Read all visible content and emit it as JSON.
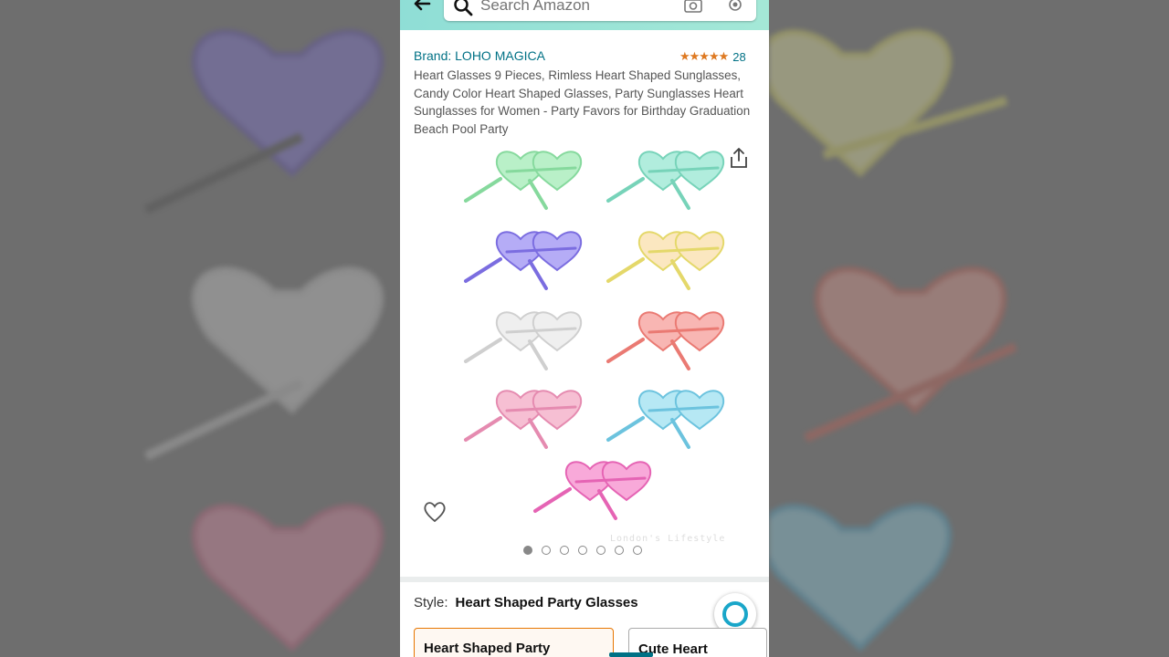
{
  "search": {
    "placeholder": "Search Amazon"
  },
  "product": {
    "brand": "Brand: LOHO MAGICA",
    "stars": "★★★★★",
    "rating": 4.5,
    "rating_count": "28",
    "title": "Heart Glasses 9 Pieces, Rimless Heart Shaped Sunglasses, Candy Color Heart Shaped Glasses, Party Sunglasses Heart Sunglasses for Women - Party Favors for Birthday Graduation Beach Pool Party"
  },
  "gallery": {
    "watermark": "London's Lifestyle",
    "image_count": 7,
    "active_image": 1,
    "glasses_colors": [
      "#a8ecc0",
      "#9ae7d3",
      "#a79cf3",
      "#f8e3a8",
      "#e3e3e3",
      "#f6a1a1",
      "#f3a3c4",
      "#9fdff0",
      "#f07ec8"
    ]
  },
  "style": {
    "label": "Style:",
    "value": "Heart Shaped Party Glasses",
    "options": [
      "Heart Shaped Party",
      "Cute Heart"
    ]
  },
  "colors": {
    "accent": "#007185",
    "star": "#de7921",
    "topbar": "#8fded6",
    "selected_border": "#e77600"
  },
  "icons": [
    "back-arrow-icon",
    "search-icon",
    "camera-icon",
    "mic-icon",
    "share-icon",
    "heart-icon",
    "alexa-icon"
  ]
}
